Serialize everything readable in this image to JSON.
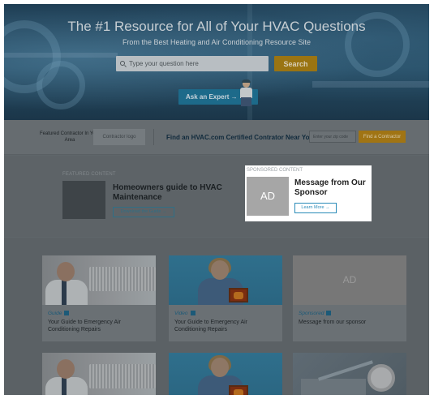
{
  "hero": {
    "title": "The #1 Resource for All of Your HVAC Questions",
    "subtitle": "From the Best Heating and Air Conditioning Resource Site",
    "search_placeholder": "Type your question here",
    "search_button": "Search",
    "expert_button": "Ask an Expert →"
  },
  "contractor": {
    "featured_label": "Featured Contractor In Your Area",
    "logo_placeholder": "Contractor logo",
    "find_text": "Find an HVAC.com Certified Contrator Near You",
    "zip_placeholder": "Enter your zip code",
    "find_button": "Find a Contractor"
  },
  "featured": {
    "heading": "FEATURED CONTENT",
    "title": "Homeowners guide to HVAC Maintenance",
    "button": "Download the Guide →"
  },
  "sponsored": {
    "heading": "SPONSORED CONTENT",
    "thumb_label": "AD",
    "title": "Message from Our Sponsor",
    "button": "Learn More →"
  },
  "cards": [
    {
      "tag": "Guide",
      "icon": "document-icon",
      "title": "Your Guide to Emergency Air Conditioning Repairs"
    },
    {
      "tag": "Video",
      "icon": "video-camera-icon",
      "title": "Your Guide to Emergency Air Conditioning Repairs"
    },
    {
      "tag": "Sponsored",
      "icon": "ad-icon",
      "title": "Message from our sponsor",
      "ad_label": "AD"
    }
  ],
  "colors": {
    "accent_orange": "#f2a91f",
    "accent_blue": "#2a8bb8",
    "overlay": "#5f666a"
  }
}
